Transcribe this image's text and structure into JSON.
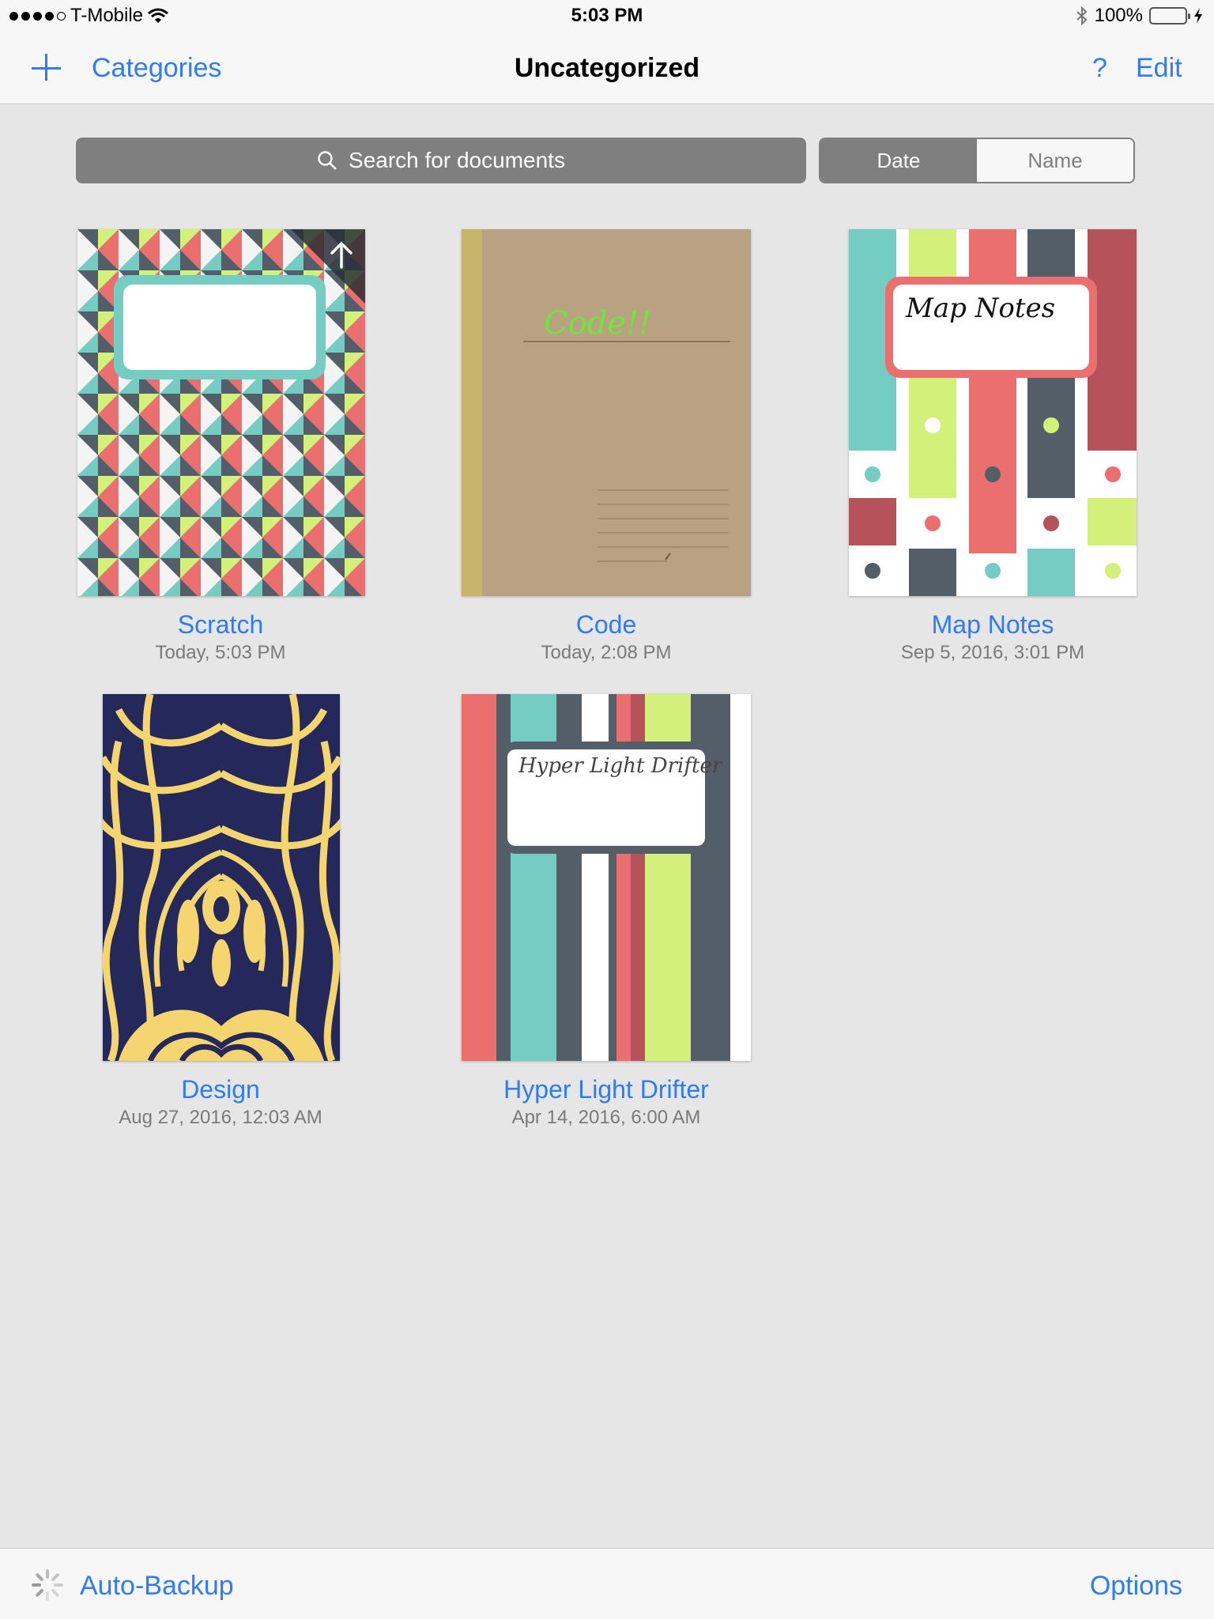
{
  "status_bar": {
    "carrier": "T-Mobile",
    "time": "5:03 PM",
    "battery": "100%"
  },
  "nav": {
    "categories_label": "Categories",
    "title": "Uncategorized",
    "help_label": "?",
    "edit_label": "Edit"
  },
  "search": {
    "placeholder": "Search for documents"
  },
  "sort": {
    "date_label": "Date",
    "name_label": "Name",
    "selected": "Date"
  },
  "documents": [
    {
      "title": "Scratch",
      "date": "Today, 5:03 PM"
    },
    {
      "title": "Code",
      "date": "Today, 2:08 PM",
      "handwriting": "Code!!"
    },
    {
      "title": "Map Notes",
      "date": "Sep 5, 2016, 3:01 PM",
      "handwriting": "Map Notes"
    },
    {
      "title": "Design",
      "date": "Aug 27, 2016, 12:03 AM"
    },
    {
      "title": "Hyper Light Drifter",
      "date": "Apr 14, 2016, 6:00 AM",
      "handwriting": "Hyper Light Drifter"
    }
  ],
  "toolbar": {
    "backup_label": "Auto-Backup",
    "options_label": "Options"
  },
  "colors": {
    "accent": "#2f7bf5",
    "coral": "#ec6f6f",
    "teal": "#75ccc2",
    "lime": "#d2f07a",
    "slate": "#545e69",
    "navy": "#24285a",
    "gold": "#f5d56f"
  }
}
